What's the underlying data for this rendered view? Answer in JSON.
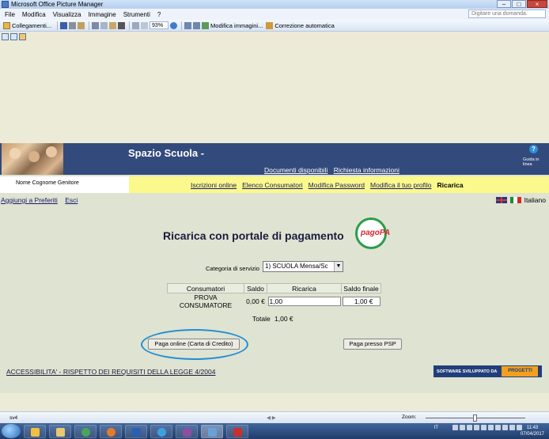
{
  "window": {
    "title": "Microsoft Office Picture Manager",
    "minimize": "–",
    "maximize": "□",
    "close": "×"
  },
  "menu": {
    "items": [
      "File",
      "Modifica",
      "Visualizza",
      "Immagine",
      "Strumenti",
      "?"
    ],
    "help_placeholder": "Digitare una domanda."
  },
  "toolbar": {
    "shortcuts_label": "Collegamenti...",
    "zoom_value": "93%",
    "edit_images_label": "Modifica immagini...",
    "autocorrect_label": "Correzione automatica"
  },
  "site": {
    "title": "Spazio Scuola -",
    "top_links": [
      "Documenti disponibili",
      "Richiesta informazioni"
    ],
    "help_icon": "?",
    "help_label": "Guida in linea",
    "user_name": "Nome Cognome Genitore",
    "nav": [
      "Iscrizioni online",
      "Elenco Consumatori",
      "Modifica Password",
      "Modifica il tuo profilo"
    ],
    "nav_current": "Ricarica",
    "sub_links": [
      "Aggiungi a Preferiti",
      "Esci"
    ],
    "language": "Italiano"
  },
  "form": {
    "heading": "Ricarica con portale di pagamento",
    "pagopa_logo_text": "pagoPA",
    "category_label": "Categoria di servizio",
    "category_value": "1) SCUOLA Mensa/Sc",
    "columns": [
      "Consumatori",
      "Saldo",
      "Ricarica",
      "Saldo finale"
    ],
    "rows": [
      {
        "consumer": "PROVA CONSUMATORE",
        "balance": "0,00 €",
        "recharge": "1,00",
        "final": "1,00 €"
      }
    ],
    "total_label": "Totale",
    "total_value": "1,00 €",
    "pay_card_label": "Paga online (Carta di Credito)",
    "pay_psp_label": "Paga presso PSP"
  },
  "footer": {
    "accessibility": "ACCESSIBILITA' - RISPETTO DEI REQUISITI DELLA LEGGE 4/2004",
    "badge_text": "SOFTWARE SVILUPPATO DA",
    "badge_logo": "PROGETTI"
  },
  "status": {
    "left": "sv4",
    "zoom_label": "Zoom:"
  },
  "taskbar": {
    "lang": "IT",
    "time": "11:43",
    "date": "07/04/2017"
  },
  "colors": {
    "banner": "#334a7c",
    "navbar": "#fbf98b",
    "page_bg": "#dee3d2",
    "highlight": "#1f8ed6"
  }
}
